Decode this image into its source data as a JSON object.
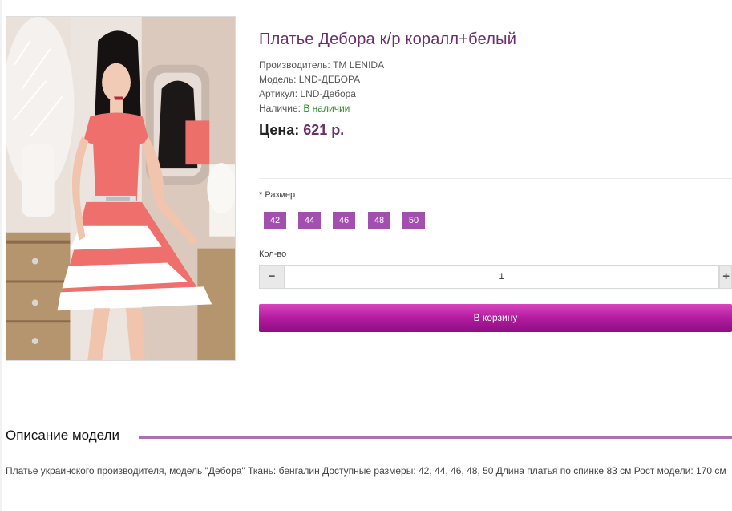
{
  "product": {
    "title": "Платье Дебора к/р коралл+белый",
    "manufacturer": "Производитель: ТМ LENIDA",
    "model": "Модель: LND-ДЕБОРА",
    "sku": "Артикул: LND-Дебора",
    "availability_label": "Наличие: ",
    "availability_value": "В наличии",
    "price_label": "Цена: ",
    "price_value": "621 р."
  },
  "options": {
    "size_required_mark": "*",
    "size_label": "Размер",
    "sizes": [
      "42",
      "44",
      "46",
      "48",
      "50"
    ]
  },
  "quantity": {
    "label": "Кол-во",
    "value": "1",
    "minus": "−",
    "plus": "+"
  },
  "cart": {
    "button_label": "В корзину"
  },
  "description": {
    "title": "Описание модели",
    "text": "Платье украинского производителя, модель \"Дебора\" Ткань: бенгалин Доступные размеры: 42, 44, 46, 48, 50 Длина платья по спинке 83 см Рост модели: 170 см"
  },
  "colors": {
    "title": "#6b2f6e",
    "size_button": "#a24fb0",
    "cart_button": "#b21ba0",
    "in_stock": "#2a8a2a",
    "section_rule": "#b06fb4"
  }
}
